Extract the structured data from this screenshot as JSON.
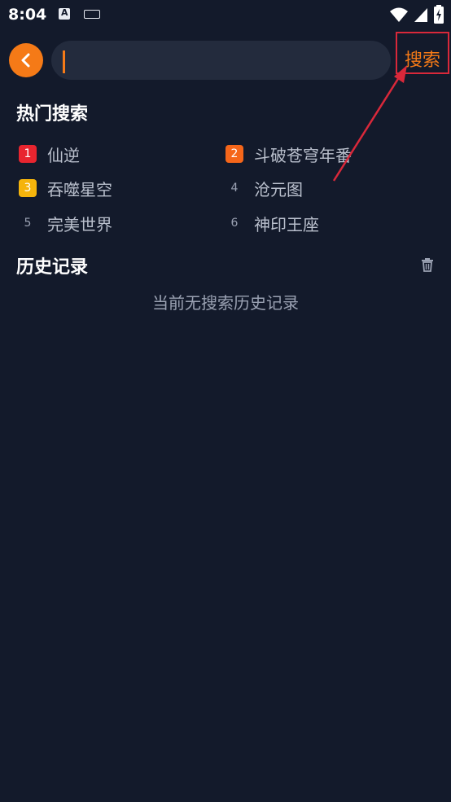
{
  "status_bar": {
    "time": "8:04",
    "icons": [
      "a-icon",
      "keyboard-icon",
      "wifi-icon",
      "signal-icon",
      "battery-icon"
    ]
  },
  "header": {
    "back_icon": "chevron-left-icon",
    "search_placeholder": "",
    "search_value": "",
    "search_label": "搜索"
  },
  "hot_search": {
    "title": "热门搜索",
    "items": [
      {
        "rank": "1",
        "label": "仙逆",
        "color": "#e8252f"
      },
      {
        "rank": "2",
        "label": "斗破苍穹年番",
        "color": "#f5661a"
      },
      {
        "rank": "3",
        "label": "吞噬星空",
        "color": "#f5b40c"
      },
      {
        "rank": "4",
        "label": "沧元图",
        "color": ""
      },
      {
        "rank": "5",
        "label": "完美世界",
        "color": ""
      },
      {
        "rank": "6",
        "label": "神印王座",
        "color": ""
      }
    ]
  },
  "history": {
    "title": "历史记录",
    "empty_text": "当前无搜索历史记录",
    "clear_icon": "trash-icon"
  },
  "colors": {
    "background": "#131a2b",
    "accent": "#f57a17",
    "search_box": "#232b3d",
    "highlight_box": "#d9283a"
  }
}
